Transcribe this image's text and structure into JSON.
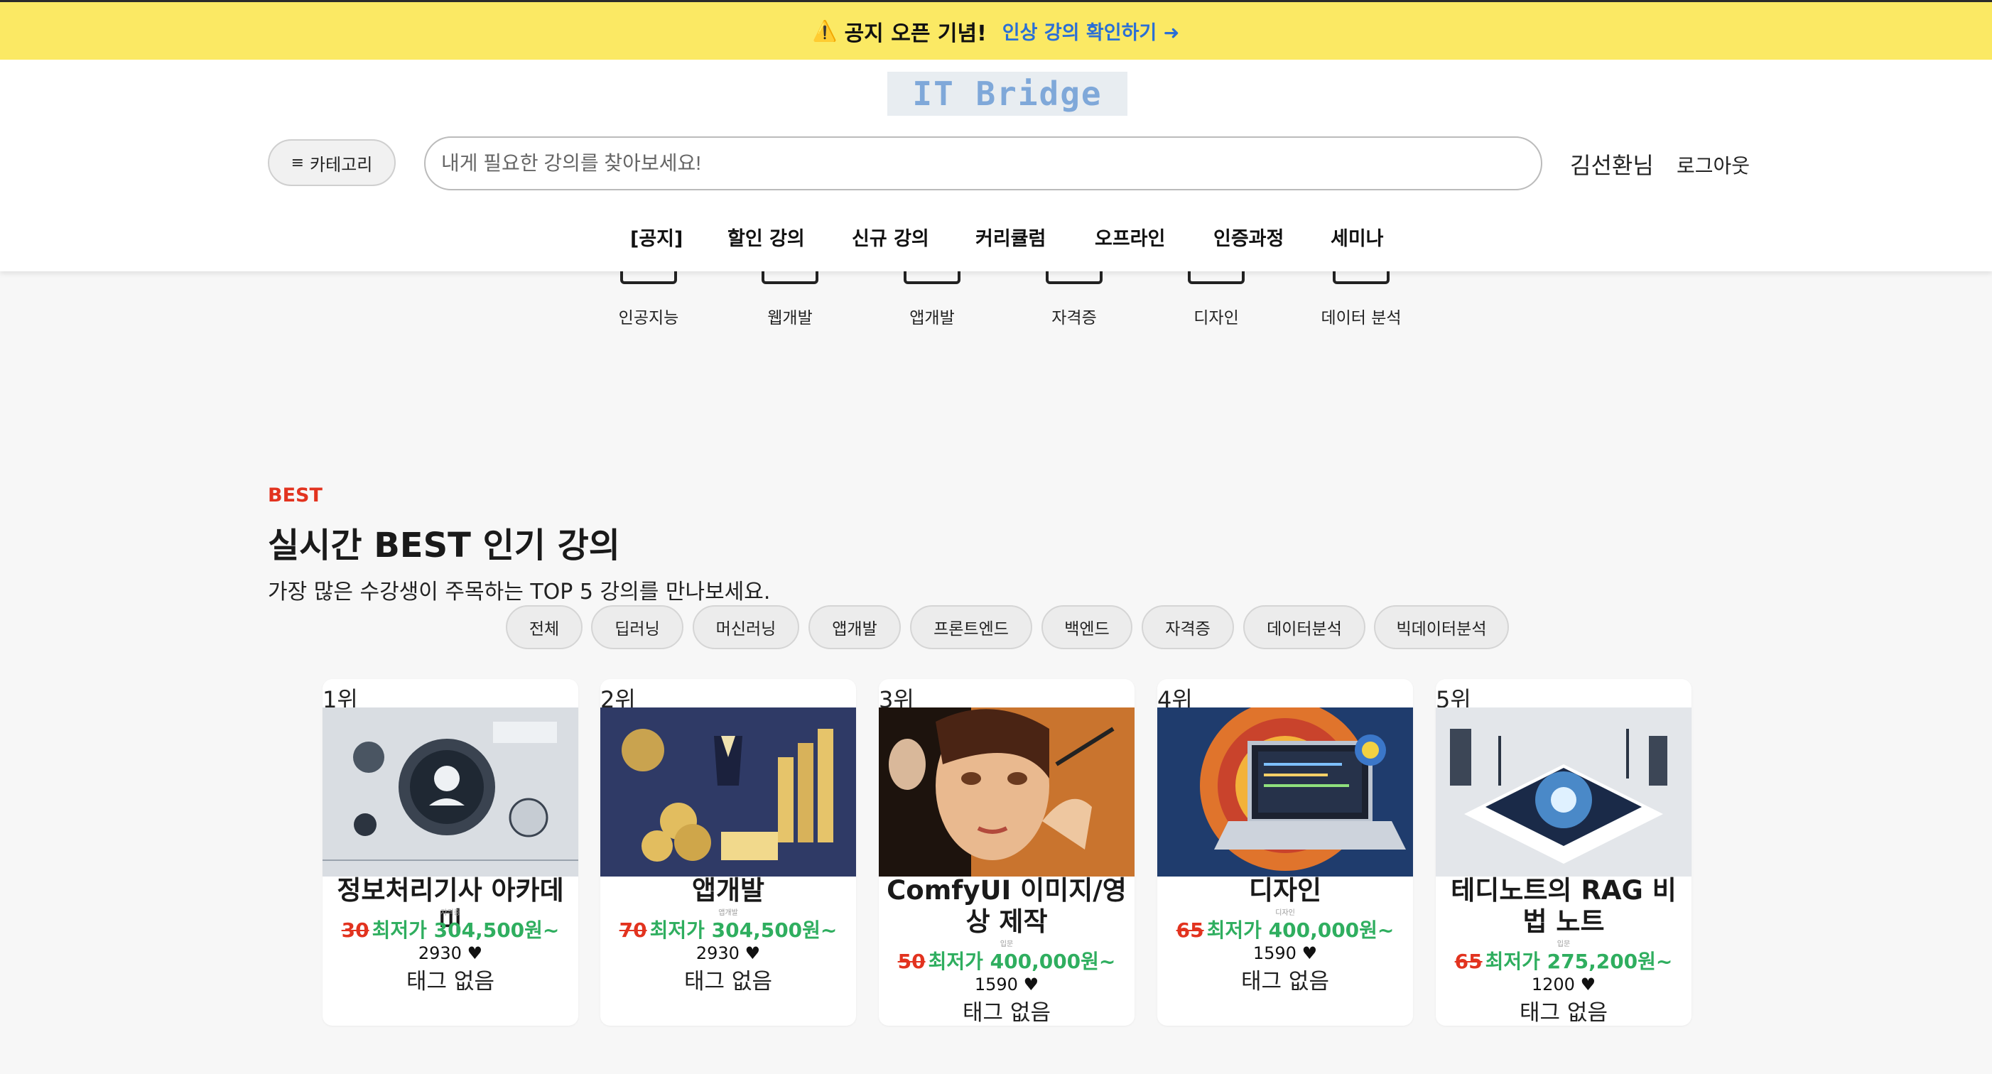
{
  "notice": {
    "warn_icon": "warning-icon",
    "title": "공지 오픈 기념!",
    "link": "인상 강의 확인하기 ➜"
  },
  "header": {
    "logo_text": "IT Bridge",
    "category_button": "카테고리",
    "search_placeholder": "내게 필요한 강의를 찾아보세요!",
    "user_name": "김선환님",
    "logout": "로그아웃",
    "nav": [
      "[공지]",
      "할인 강의",
      "신규 강의",
      "커리큘럼",
      "오프라인",
      "인증과정",
      "세미나"
    ]
  },
  "categories": [
    {
      "label": "인공지능",
      "icon": "ai-chip-icon"
    },
    {
      "label": "웹개발",
      "icon": "web-monitor-icon"
    },
    {
      "label": "앱개발",
      "icon": "app-device-icon"
    },
    {
      "label": "자격증",
      "icon": "certificate-icon"
    },
    {
      "label": "디자인",
      "icon": "design-pen-icon"
    },
    {
      "label": "데이터 분석",
      "icon": "data-chart-icon"
    }
  ],
  "best": {
    "tag": "BEST",
    "title": "실시간 BEST 인기 강의",
    "subtitle": "가장 많은 수강생이 주목하는 TOP 5 강의를 만나보세요.",
    "filters": [
      "전체",
      "딥러닝",
      "머신러닝",
      "앱개발",
      "프론트엔드",
      "백엔드",
      "자격증",
      "데이터분석",
      "빅데이터분석"
    ]
  },
  "cards": [
    {
      "rank": "1위",
      "title": "정보처리기사 아카데미",
      "mini": "자격증",
      "discount": "30",
      "price": "최저가 304,500원~",
      "likes": "2930 ♥",
      "tags": "태그 없음"
    },
    {
      "rank": "2위",
      "title": "앱개발",
      "mini": "앱개발",
      "discount": "70",
      "price": "최저가 304,500원~",
      "likes": "2930 ♥",
      "tags": "태그 없음"
    },
    {
      "rank": "3위",
      "title": "ComfyUI 이미지/영상 제작",
      "mini": "입문",
      "discount": "50",
      "price": "최저가 400,000원~",
      "likes": "1590 ♥",
      "tags": "태그 없음"
    },
    {
      "rank": "4위",
      "title": "디자인",
      "mini": "디자인",
      "discount": "65",
      "price": "최저가 400,000원~",
      "likes": "1590 ♥",
      "tags": "태그 없음"
    },
    {
      "rank": "5위",
      "title": "테디노트의 RAG 비법 노트",
      "mini": "입문",
      "discount": "65",
      "price": "최저가 275,200원~",
      "likes": "1200 ♥",
      "tags": "태그 없음"
    }
  ]
}
